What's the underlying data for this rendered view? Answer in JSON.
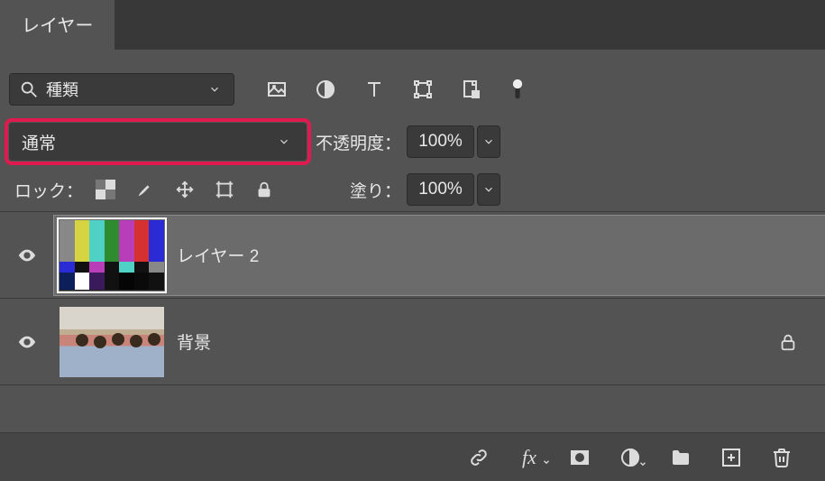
{
  "panel": {
    "title": "レイヤー"
  },
  "filter": {
    "label": "種類"
  },
  "blend": {
    "mode": "通常",
    "opacity_label": "不透明度：",
    "opacity_value": "100%"
  },
  "lock": {
    "label": "ロック：",
    "fill_label": "塗り：",
    "fill_value": "100%"
  },
  "layers": [
    {
      "name": "レイヤー 2",
      "selected": true,
      "locked": false,
      "thumb": "bars"
    },
    {
      "name": "背景",
      "selected": false,
      "locked": true,
      "thumb": "photo"
    }
  ]
}
